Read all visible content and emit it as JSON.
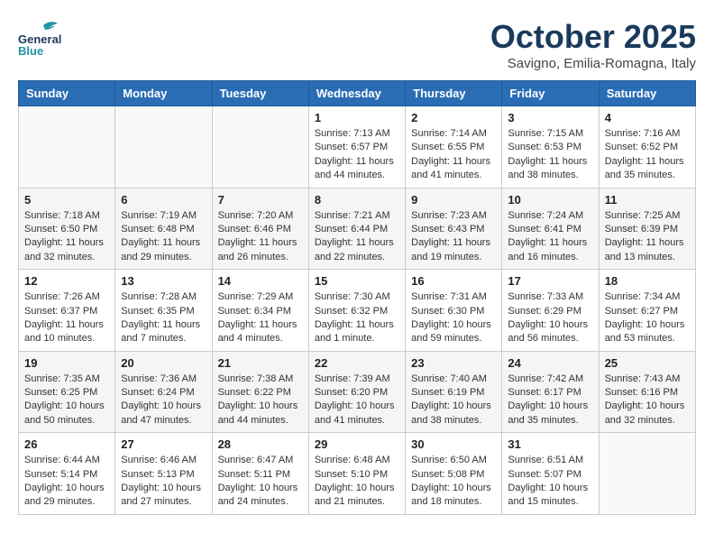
{
  "header": {
    "logo_line1": "General",
    "logo_line2": "Blue",
    "month_title": "October 2025",
    "location": "Savigno, Emilia-Romagna, Italy"
  },
  "weekdays": [
    "Sunday",
    "Monday",
    "Tuesday",
    "Wednesday",
    "Thursday",
    "Friday",
    "Saturday"
  ],
  "weeks": [
    [
      {
        "day": "",
        "info": ""
      },
      {
        "day": "",
        "info": ""
      },
      {
        "day": "",
        "info": ""
      },
      {
        "day": "1",
        "info": "Sunrise: 7:13 AM\nSunset: 6:57 PM\nDaylight: 11 hours and 44 minutes."
      },
      {
        "day": "2",
        "info": "Sunrise: 7:14 AM\nSunset: 6:55 PM\nDaylight: 11 hours and 41 minutes."
      },
      {
        "day": "3",
        "info": "Sunrise: 7:15 AM\nSunset: 6:53 PM\nDaylight: 11 hours and 38 minutes."
      },
      {
        "day": "4",
        "info": "Sunrise: 7:16 AM\nSunset: 6:52 PM\nDaylight: 11 hours and 35 minutes."
      }
    ],
    [
      {
        "day": "5",
        "info": "Sunrise: 7:18 AM\nSunset: 6:50 PM\nDaylight: 11 hours and 32 minutes."
      },
      {
        "day": "6",
        "info": "Sunrise: 7:19 AM\nSunset: 6:48 PM\nDaylight: 11 hours and 29 minutes."
      },
      {
        "day": "7",
        "info": "Sunrise: 7:20 AM\nSunset: 6:46 PM\nDaylight: 11 hours and 26 minutes."
      },
      {
        "day": "8",
        "info": "Sunrise: 7:21 AM\nSunset: 6:44 PM\nDaylight: 11 hours and 22 minutes."
      },
      {
        "day": "9",
        "info": "Sunrise: 7:23 AM\nSunset: 6:43 PM\nDaylight: 11 hours and 19 minutes."
      },
      {
        "day": "10",
        "info": "Sunrise: 7:24 AM\nSunset: 6:41 PM\nDaylight: 11 hours and 16 minutes."
      },
      {
        "day": "11",
        "info": "Sunrise: 7:25 AM\nSunset: 6:39 PM\nDaylight: 11 hours and 13 minutes."
      }
    ],
    [
      {
        "day": "12",
        "info": "Sunrise: 7:26 AM\nSunset: 6:37 PM\nDaylight: 11 hours and 10 minutes."
      },
      {
        "day": "13",
        "info": "Sunrise: 7:28 AM\nSunset: 6:35 PM\nDaylight: 11 hours and 7 minutes."
      },
      {
        "day": "14",
        "info": "Sunrise: 7:29 AM\nSunset: 6:34 PM\nDaylight: 11 hours and 4 minutes."
      },
      {
        "day": "15",
        "info": "Sunrise: 7:30 AM\nSunset: 6:32 PM\nDaylight: 11 hours and 1 minute."
      },
      {
        "day": "16",
        "info": "Sunrise: 7:31 AM\nSunset: 6:30 PM\nDaylight: 10 hours and 59 minutes."
      },
      {
        "day": "17",
        "info": "Sunrise: 7:33 AM\nSunset: 6:29 PM\nDaylight: 10 hours and 56 minutes."
      },
      {
        "day": "18",
        "info": "Sunrise: 7:34 AM\nSunset: 6:27 PM\nDaylight: 10 hours and 53 minutes."
      }
    ],
    [
      {
        "day": "19",
        "info": "Sunrise: 7:35 AM\nSunset: 6:25 PM\nDaylight: 10 hours and 50 minutes."
      },
      {
        "day": "20",
        "info": "Sunrise: 7:36 AM\nSunset: 6:24 PM\nDaylight: 10 hours and 47 minutes."
      },
      {
        "day": "21",
        "info": "Sunrise: 7:38 AM\nSunset: 6:22 PM\nDaylight: 10 hours and 44 minutes."
      },
      {
        "day": "22",
        "info": "Sunrise: 7:39 AM\nSunset: 6:20 PM\nDaylight: 10 hours and 41 minutes."
      },
      {
        "day": "23",
        "info": "Sunrise: 7:40 AM\nSunset: 6:19 PM\nDaylight: 10 hours and 38 minutes."
      },
      {
        "day": "24",
        "info": "Sunrise: 7:42 AM\nSunset: 6:17 PM\nDaylight: 10 hours and 35 minutes."
      },
      {
        "day": "25",
        "info": "Sunrise: 7:43 AM\nSunset: 6:16 PM\nDaylight: 10 hours and 32 minutes."
      }
    ],
    [
      {
        "day": "26",
        "info": "Sunrise: 6:44 AM\nSunset: 5:14 PM\nDaylight: 10 hours and 29 minutes."
      },
      {
        "day": "27",
        "info": "Sunrise: 6:46 AM\nSunset: 5:13 PM\nDaylight: 10 hours and 27 minutes."
      },
      {
        "day": "28",
        "info": "Sunrise: 6:47 AM\nSunset: 5:11 PM\nDaylight: 10 hours and 24 minutes."
      },
      {
        "day": "29",
        "info": "Sunrise: 6:48 AM\nSunset: 5:10 PM\nDaylight: 10 hours and 21 minutes."
      },
      {
        "day": "30",
        "info": "Sunrise: 6:50 AM\nSunset: 5:08 PM\nDaylight: 10 hours and 18 minutes."
      },
      {
        "day": "31",
        "info": "Sunrise: 6:51 AM\nSunset: 5:07 PM\nDaylight: 10 hours and 15 minutes."
      },
      {
        "day": "",
        "info": ""
      }
    ]
  ]
}
